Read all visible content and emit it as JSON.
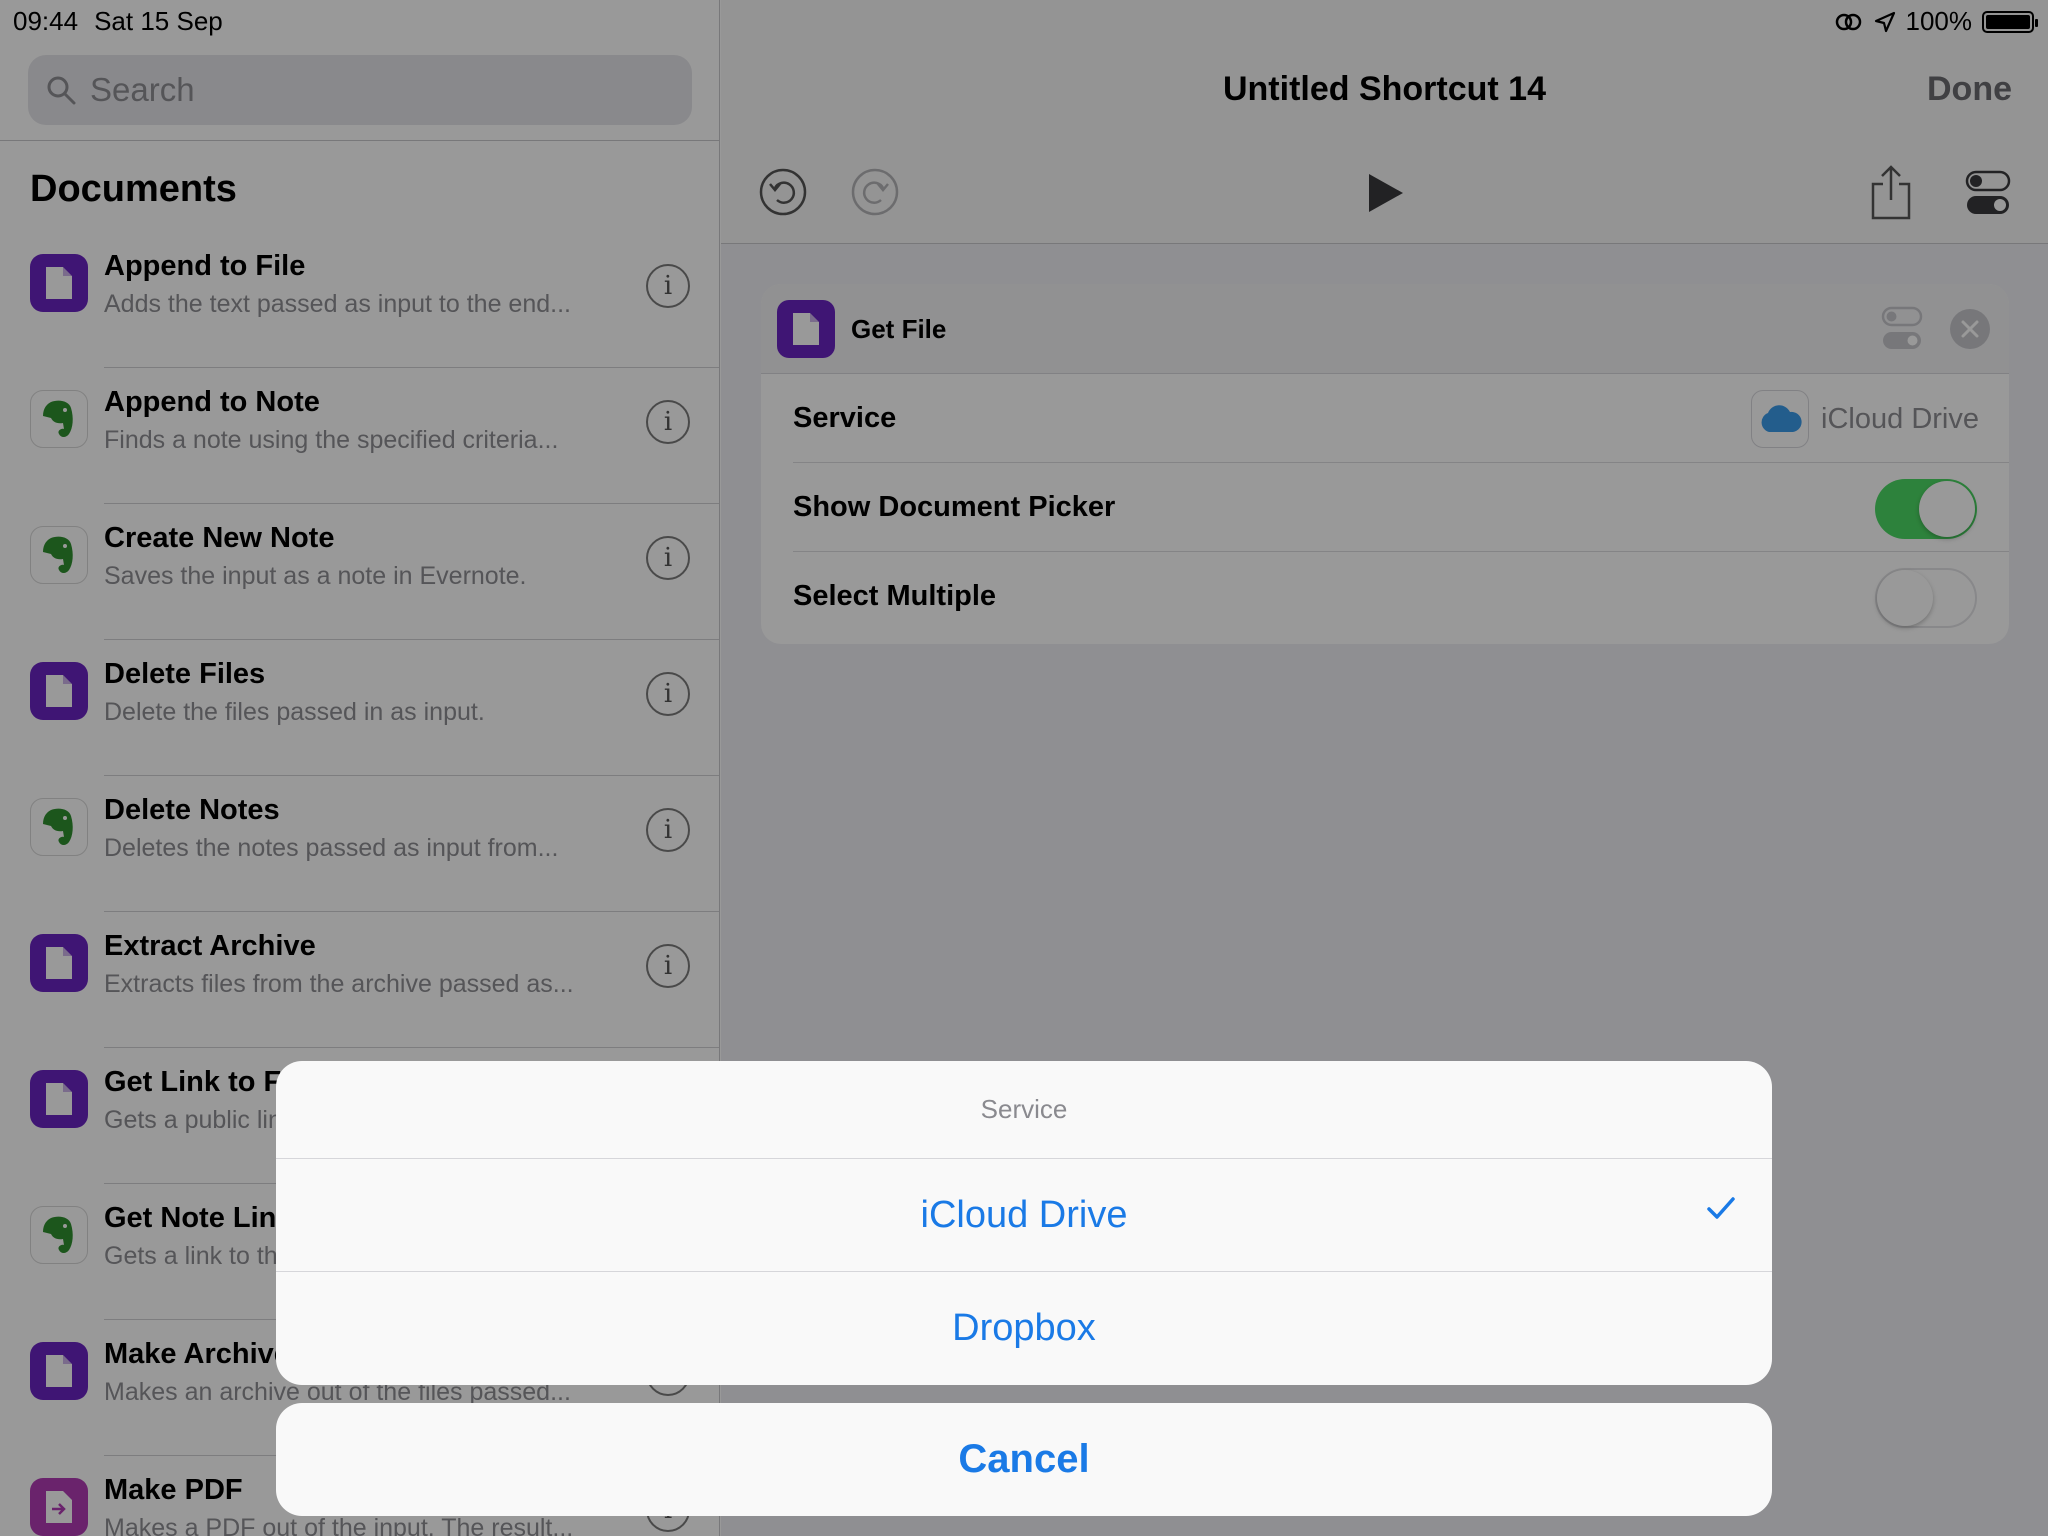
{
  "status": {
    "time": "09:44",
    "date": "Sat 15 Sep",
    "battery": "100%"
  },
  "search": {
    "placeholder": "Search"
  },
  "sidebar": {
    "section": "Documents",
    "items": [
      {
        "title": "Append to File",
        "desc": "Adds the text passed as input to the end...",
        "icon": "document-icon",
        "color": "#6a23c2"
      },
      {
        "title": "Append to Note",
        "desc": "Finds a note using the specified criteria...",
        "icon": "evernote-icon",
        "color": "#2dbe60"
      },
      {
        "title": "Create New Note",
        "desc": "Saves the input as a note in Evernote.",
        "icon": "evernote-icon",
        "color": "#2dbe60"
      },
      {
        "title": "Delete Files",
        "desc": "Delete the files passed in as input.",
        "icon": "document-icon",
        "color": "#6a23c2"
      },
      {
        "title": "Delete Notes",
        "desc": "Deletes the notes passed as input from...",
        "icon": "evernote-icon",
        "color": "#2dbe60"
      },
      {
        "title": "Extract Archive",
        "desc": "Extracts files from the archive passed as...",
        "icon": "document-icon",
        "color": "#6a23c2"
      },
      {
        "title": "Get Link to File",
        "desc": "Gets a public link to the file passed...",
        "icon": "document-icon",
        "color": "#6a23c2"
      },
      {
        "title": "Get Note Link",
        "desc": "Gets a link to the note passed...",
        "icon": "evernote-icon",
        "color": "#2dbe60"
      },
      {
        "title": "Make Archive",
        "desc": "Makes an archive out of the files passed...",
        "icon": "document-icon",
        "color": "#6a23c2"
      },
      {
        "title": "Make PDF",
        "desc": "Makes a PDF out of the input. The result...",
        "icon": "pdf-icon",
        "color": "#b13bb5"
      }
    ]
  },
  "editor": {
    "title": "Untitled Shortcut 14",
    "done": "Done",
    "action": {
      "name": "Get File",
      "service_label": "Service",
      "service_value": "iCloud Drive",
      "picker_label": "Show Document Picker",
      "picker_on": true,
      "multiple_label": "Select Multiple",
      "multiple_on": false
    }
  },
  "sheet": {
    "title": "Service",
    "options": [
      {
        "label": "iCloud Drive",
        "selected": true
      },
      {
        "label": "Dropbox",
        "selected": false
      }
    ],
    "cancel": "Cancel"
  },
  "colors": {
    "accent": "#1a7ae6",
    "toggle_on": "#4cd964",
    "document_purple": "#6a23c2"
  }
}
